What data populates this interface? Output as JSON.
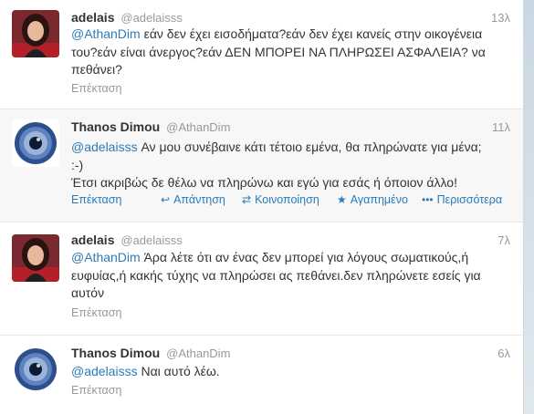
{
  "tweets": [
    {
      "name": "adelais",
      "handle": "@adelaisss",
      "time": "13λ",
      "mention": "@AthanDim",
      "line1": " εάν δεν έχει εισοδήματα?εάν δεν έχει κανείς στην οικογένεια",
      "line2": "του?εάν είναι άνεργος?εάν ΔΕΝ ΜΠΟΡΕΙ ΝΑ ΠΛΗΡΩΣΕΙ ΑΣΦΑΛΕΙΑ? να",
      "line3": "πεθάνει?",
      "expand": "Επέκταση"
    },
    {
      "name": "Thanos Dimou",
      "handle": "@AthanDim",
      "time": "11λ",
      "mention": "@adelaisss",
      "line1": " Αν μου συνέβαινε κάτι τέτοιο εμένα, θα πληρώνατε για μένα;",
      "line2": ":-)",
      "line3": "Έτσι ακριβώς δε θέλω να πληρώνω και εγώ για εσάς ή όποιον άλλο!",
      "expand": "Επέκταση",
      "reply": "Απάντηση",
      "retweet": "Κοινοποίηση",
      "favorite": "Αγαπημένο",
      "more": "Περισσότερα"
    },
    {
      "name": "adelais",
      "handle": "@adelaisss",
      "time": "7λ",
      "mention": "@AthanDim",
      "line1": " Άρα λέτε ότι αν ένας δεν μπορεί για λόγους σωματικούς,ή",
      "line2": "ευφυίας,ή κακής τύχης να πληρώσει ας πεθάνει.δεν πληρώνετε εσείς για",
      "line3": "αυτόν",
      "expand": "Επέκταση"
    },
    {
      "name": "Thanos Dimou",
      "handle": "@AthanDim",
      "time": "6λ",
      "mention": "@adelaisss",
      "line1": " Ναι αυτό λέω.",
      "expand": "Επέκταση"
    }
  ],
  "icons": {
    "reply": "reply-arrow-icon",
    "retweet": "retweet-icon",
    "favorite": "star-icon",
    "more": "ellipsis-icon"
  },
  "colors": {
    "link": "#2b7bb9",
    "muted": "#999999",
    "text": "#333333"
  }
}
